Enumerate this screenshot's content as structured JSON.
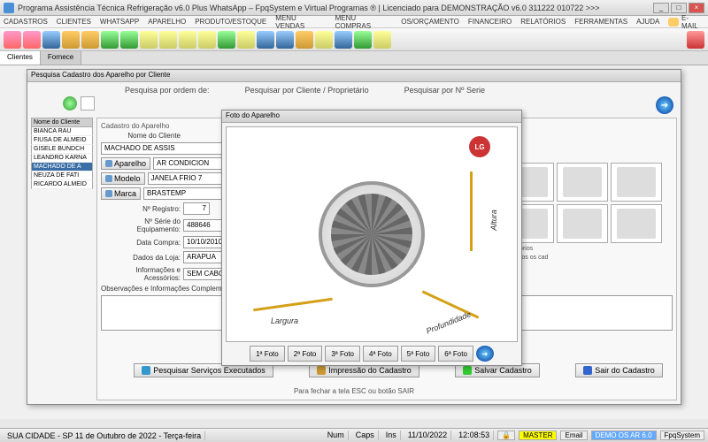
{
  "window": {
    "title": "Programa Assistência Técnica Refrigeração v6.0 Plus WhatsApp – FpqSystem e Virtual Programas ® | Licenciado para  DEMONSTRAÇÃO v6.0 311222 010722 >>>"
  },
  "menu": {
    "items": [
      "CADASTROS",
      "CLIENTES",
      "WHATSAPP",
      "APARELHO",
      "PRODUTO/ESTOQUE",
      "MENU VENDAS",
      "MENU COMPRAS",
      "OS/ORÇAMENTO",
      "FINANCEIRO",
      "RELATÓRIOS",
      "FERRAMENTAS",
      "AJUDA"
    ],
    "email": "E-MAIL"
  },
  "maintabs": {
    "items": [
      "Clientes",
      "Fornece"
    ],
    "active": 0
  },
  "searchwin": {
    "title": "Pesquisa Cadastro dos Aparelho por Cliente",
    "search_order": "Pesquisa por ordem de:",
    "search_client": "Pesquisar por Cliente / Proprietário",
    "search_serial": "Pesquisar por Nº Serie"
  },
  "clientlist": {
    "header": "Nome do Cliente",
    "items": [
      "BIANCA RAU",
      "FIUSA DE ALMEID",
      "GISELE BUNDCH",
      "LEANDRO KARNA",
      "MACHADO DE A",
      "NEUZA DE FATI",
      "RICARDO ALMEID"
    ],
    "selected": 4
  },
  "detail": {
    "group": "Cadastro do Aparelho",
    "client_label": "Nome do Cliente",
    "client_value": "MACHADO DE ASSIS",
    "aparelho_btn": "Aparelho",
    "aparelho_value": "AR CONDICION",
    "modelo_btn": "Modelo",
    "modelo_value": "JANELA FRIO 7",
    "marca_btn": "Marca",
    "marca_value": "BRASTEMP",
    "registro_label": "Nº Registro:",
    "registro_value": "7",
    "serie_label": "Nº Série do Equipamento:",
    "serie_value": "488646",
    "data_label": "Data Compra:",
    "data_value": "10/10/2010",
    "loja_label": "Dados da Loja:",
    "loja_value": "ARAPUA",
    "info_label": "Informações e Acessórios:",
    "info_value": "SEM CABOS",
    "obs_label": "Observações e Informações Complementares",
    "side_info1": "Acessórios",
    "side_info2": "em todos os cad"
  },
  "photowin": {
    "title": "Foto do Aparelho",
    "logo": "LG",
    "dim_altura": "Altura",
    "dim_largura": "Largura",
    "dim_prof": "Profundidade",
    "buttons": [
      "1ª Foto",
      "2ª Foto",
      "3ª Foto",
      "4ª Foto",
      "5ª Foto",
      "6ª Foto"
    ]
  },
  "actions": {
    "pesquisar": "Pesquisar Serviços Executados",
    "impressao": "Impressão do Cadastro",
    "salvar": "Salvar Cadastro",
    "sair": "Sair do Cadastro",
    "hint": "Para fechar a tela ESC ou botão SAIR"
  },
  "status": {
    "city": "SUA CIDADE - SP 11 de Outubro de 2022 - Terça-feira",
    "num": "Num",
    "caps": "Caps",
    "ins": "Ins",
    "date": "11/10/2022",
    "time": "12:08:53",
    "master": "MASTER",
    "email": "Email",
    "demo": "DEMO OS AR 6.0",
    "fpq": "FpqSystem"
  }
}
